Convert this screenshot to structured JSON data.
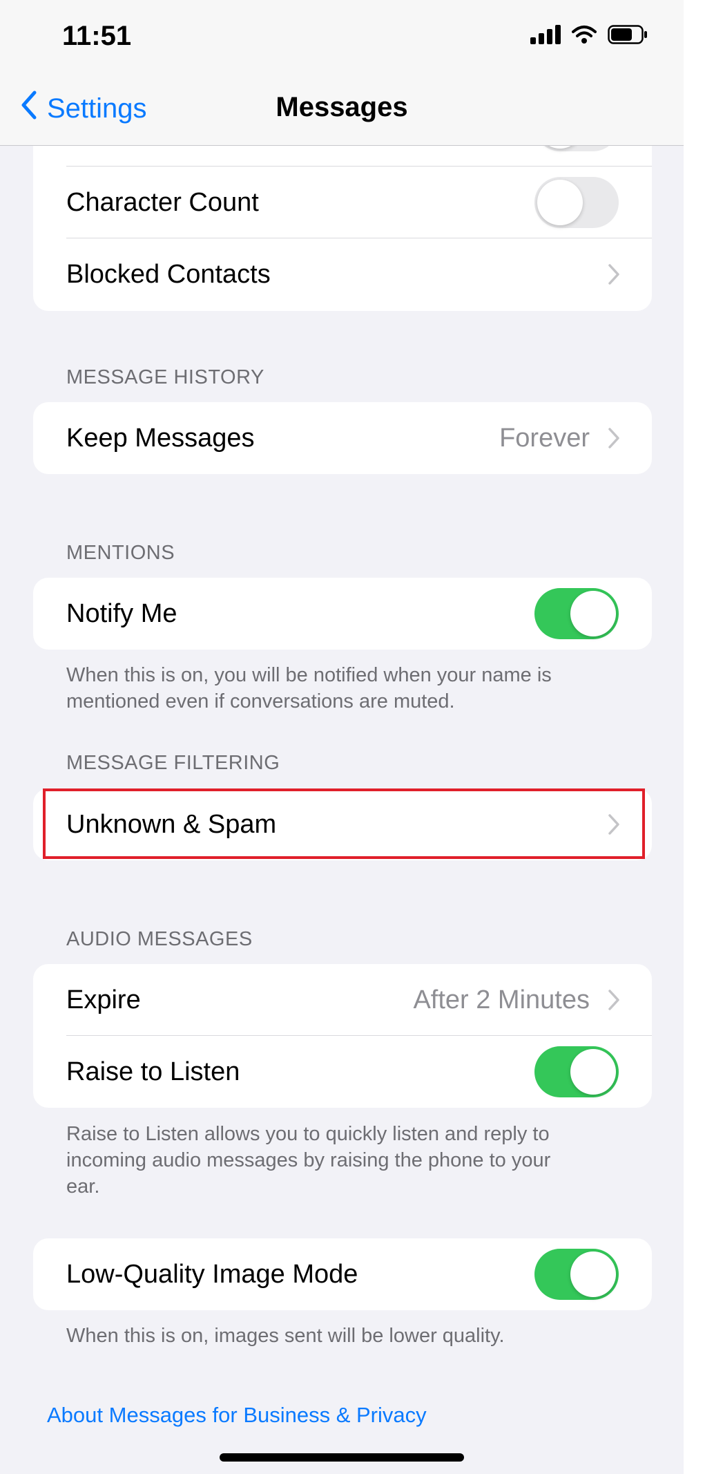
{
  "status_bar": {
    "time": "11:51"
  },
  "nav": {
    "back_label": "Settings",
    "title": "Messages"
  },
  "groups": {
    "top": {
      "character_count": {
        "label": "Character Count",
        "on": false
      },
      "blocked_contacts": {
        "label": "Blocked Contacts"
      }
    },
    "message_history": {
      "header": "MESSAGE HISTORY",
      "keep_messages": {
        "label": "Keep Messages",
        "value": "Forever"
      }
    },
    "mentions": {
      "header": "MENTIONS",
      "notify_me": {
        "label": "Notify Me",
        "on": true
      },
      "footer_line1": "When this is on, you will be notified when your name is",
      "footer_line2": "mentioned even if conversations are muted."
    },
    "message_filtering": {
      "header": "MESSAGE FILTERING",
      "unknown_spam": {
        "label": "Unknown & Spam"
      }
    },
    "audio_messages": {
      "header": "AUDIO MESSAGES",
      "expire": {
        "label": "Expire",
        "value": "After 2 Minutes"
      },
      "raise_to_listen": {
        "label": "Raise to Listen",
        "on": true
      },
      "footer_line1": "Raise to Listen allows you to quickly listen and reply to",
      "footer_line2": "incoming audio messages by raising the phone to your",
      "footer_line3": "ear."
    },
    "image": {
      "low_quality": {
        "label": "Low-Quality Image Mode",
        "on": true
      },
      "footer": "When this is on, images sent will be lower quality."
    }
  },
  "link": {
    "label": "About Messages for Business & Privacy"
  },
  "colors": {
    "accent": "#0a7aff",
    "toggle_on": "#34c759",
    "highlight": "#e0202a"
  }
}
